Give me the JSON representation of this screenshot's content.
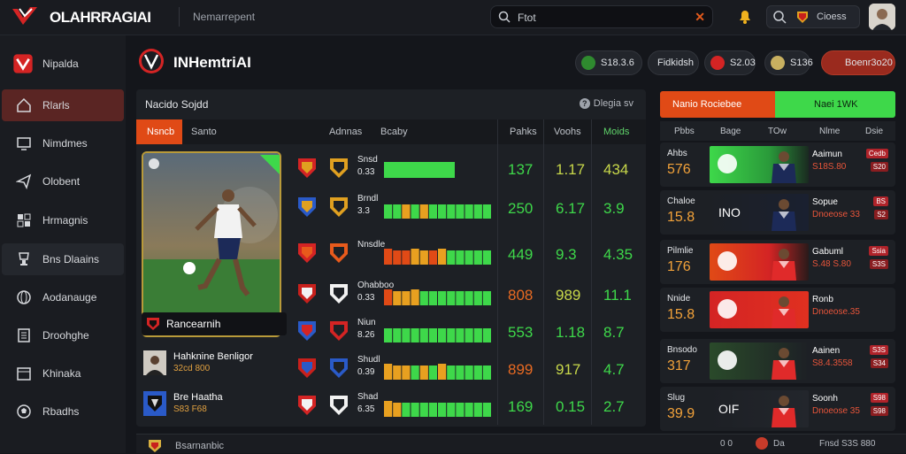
{
  "app": {
    "brand": "OLAHRRAGIAI",
    "nav_text": "Nemarrepent",
    "accent": "#e04a16",
    "green": "#3ed84a"
  },
  "search": {
    "value": "Ftot"
  },
  "topbar": {
    "right_text": "Cioess"
  },
  "sidebar": {
    "items": [
      {
        "label": "Nipalda",
        "icon": "brand-icon"
      },
      {
        "label": "Rlarls",
        "icon": "home-icon"
      },
      {
        "label": "Nimdmes",
        "icon": "monitor-icon"
      },
      {
        "label": "Olobent",
        "icon": "send-icon"
      },
      {
        "label": "Hrmagnis",
        "icon": "grid-icon"
      },
      {
        "label": "Bns Dlaains",
        "icon": "trophy-icon"
      },
      {
        "label": "Aodanauge",
        "icon": "globe-icon"
      },
      {
        "label": "Droohghe",
        "icon": "document-icon"
      },
      {
        "label": "Khinaka",
        "icon": "calendar-icon"
      },
      {
        "label": "Rbadhs",
        "icon": "ball-icon"
      }
    ]
  },
  "header": {
    "title": "INHemtriAI",
    "pills": [
      "S18.3.6",
      "Fidkidsh",
      "S2.03",
      "S136",
      "Boenr3o20"
    ]
  },
  "main": {
    "title": "Nacido Sojdd",
    "display_label": "Dlegia sv",
    "display_icon": "?",
    "tabs": [
      "Nsncb",
      "Santo"
    ],
    "col_heads": [
      "Adnnas",
      "Bcaby",
      "Pahks",
      "Voohs",
      "Moids"
    ],
    "hero_name": "Rancearnih",
    "left_list": [
      {
        "name": "Hahknine Benligor",
        "sub": "32cd 800"
      },
      {
        "name": "Bre Haatha",
        "sub": "S83 F68"
      }
    ],
    "rows": [
      {
        "n1": "Snsd",
        "n2": "0.33",
        "v1": "137",
        "v2": "1.17",
        "v3": "434",
        "c1": "#3ed84a",
        "c2": "#c8d84a",
        "c3": "#c8d84a"
      },
      {
        "n1": "Brndl",
        "n2": "3.3",
        "v1": "250",
        "v2": "6.17",
        "v3": "3.9",
        "c1": "#3ed84a",
        "c2": "#3ed84a",
        "c3": "#3ed84a"
      },
      {
        "n1": "Nnsdle",
        "n2": "",
        "v1": "449",
        "v2": "9.3",
        "v3": "4.35",
        "c1": "#3ed84a",
        "c2": "#3ed84a",
        "c3": "#3ed84a"
      },
      {
        "n1": "Ohabboo",
        "n2": "0.33",
        "v1": "808",
        "v2": "989",
        "v3": "11.1",
        "c1": "#e86a22",
        "c2": "#c8d84a",
        "c3": "#3ed84a"
      },
      {
        "n1": "Niun",
        "n2": "8.26",
        "v1": "553",
        "v2": "1.18",
        "v3": "8.7",
        "c1": "#3ed84a",
        "c2": "#3ed84a",
        "c3": "#3ed84a"
      },
      {
        "n1": "Shudl",
        "n2": "0.39",
        "v1": "899",
        "v2": "917",
        "v3": "4.7",
        "c1": "#e86a22",
        "c2": "#c8d84a",
        "c3": "#3ed84a"
      },
      {
        "n1": "Shad",
        "n2": "6.35",
        "v1": "169",
        "v2": "0.15",
        "v3": "2.7",
        "c1": "#3ed84a",
        "c2": "#3ed84a",
        "c3": "#3ed84a"
      }
    ]
  },
  "right": {
    "tab_a": "Nanio Rociebee",
    "tab_b": "Naei 1WK",
    "cols": [
      "Pbbs",
      "Bage",
      "TOw",
      "Nlme",
      "Dsie"
    ],
    "cards": [
      {
        "l1": "Ahbs",
        "l2": "576",
        "r1": "Aaimun",
        "r2": "S18S.80",
        "img_text": "",
        "badge": "Cedb",
        "badge2": "S20",
        "img": "green"
      },
      {
        "l1": "Chaloe",
        "l2": "15.8",
        "r1": "Sopue",
        "r2": "Dnoeose 33",
        "img_text": "INO",
        "badge": "BS",
        "badge2": "S2",
        "img": "dark"
      },
      {
        "l1": "Pilmlie",
        "l2": "176",
        "r1": "Gabuml",
        "r2": "S.48 S.80",
        "img_text": "",
        "badge": "Ssia",
        "badge2": "S3S",
        "img": "red"
      },
      {
        "l1": "Nnide",
        "l2": "15.8",
        "r1": "Ronb",
        "r2": "Dnoeose.35",
        "img_text": "",
        "badge": "",
        "badge2": "",
        "img": "redwide"
      },
      {
        "l1": "Bnsodo",
        "l2": "317",
        "r1": "Aainen",
        "r2": "S8.4.3558",
        "img_text": "",
        "badge": "S3S",
        "badge2": "S34",
        "img": "greendark"
      },
      {
        "l1": "Slug",
        "l2": "39.9",
        "r1": "Soonh",
        "r2": "Dnoeose 35",
        "img_text": "OIF",
        "badge": "S98",
        "badge2": "S98",
        "img": "dark2"
      }
    ]
  },
  "footer": {
    "text": "Bsarnanbic",
    "r1": "0 0",
    "r3": "Da",
    "r4": "Fnsd S3S 880"
  }
}
